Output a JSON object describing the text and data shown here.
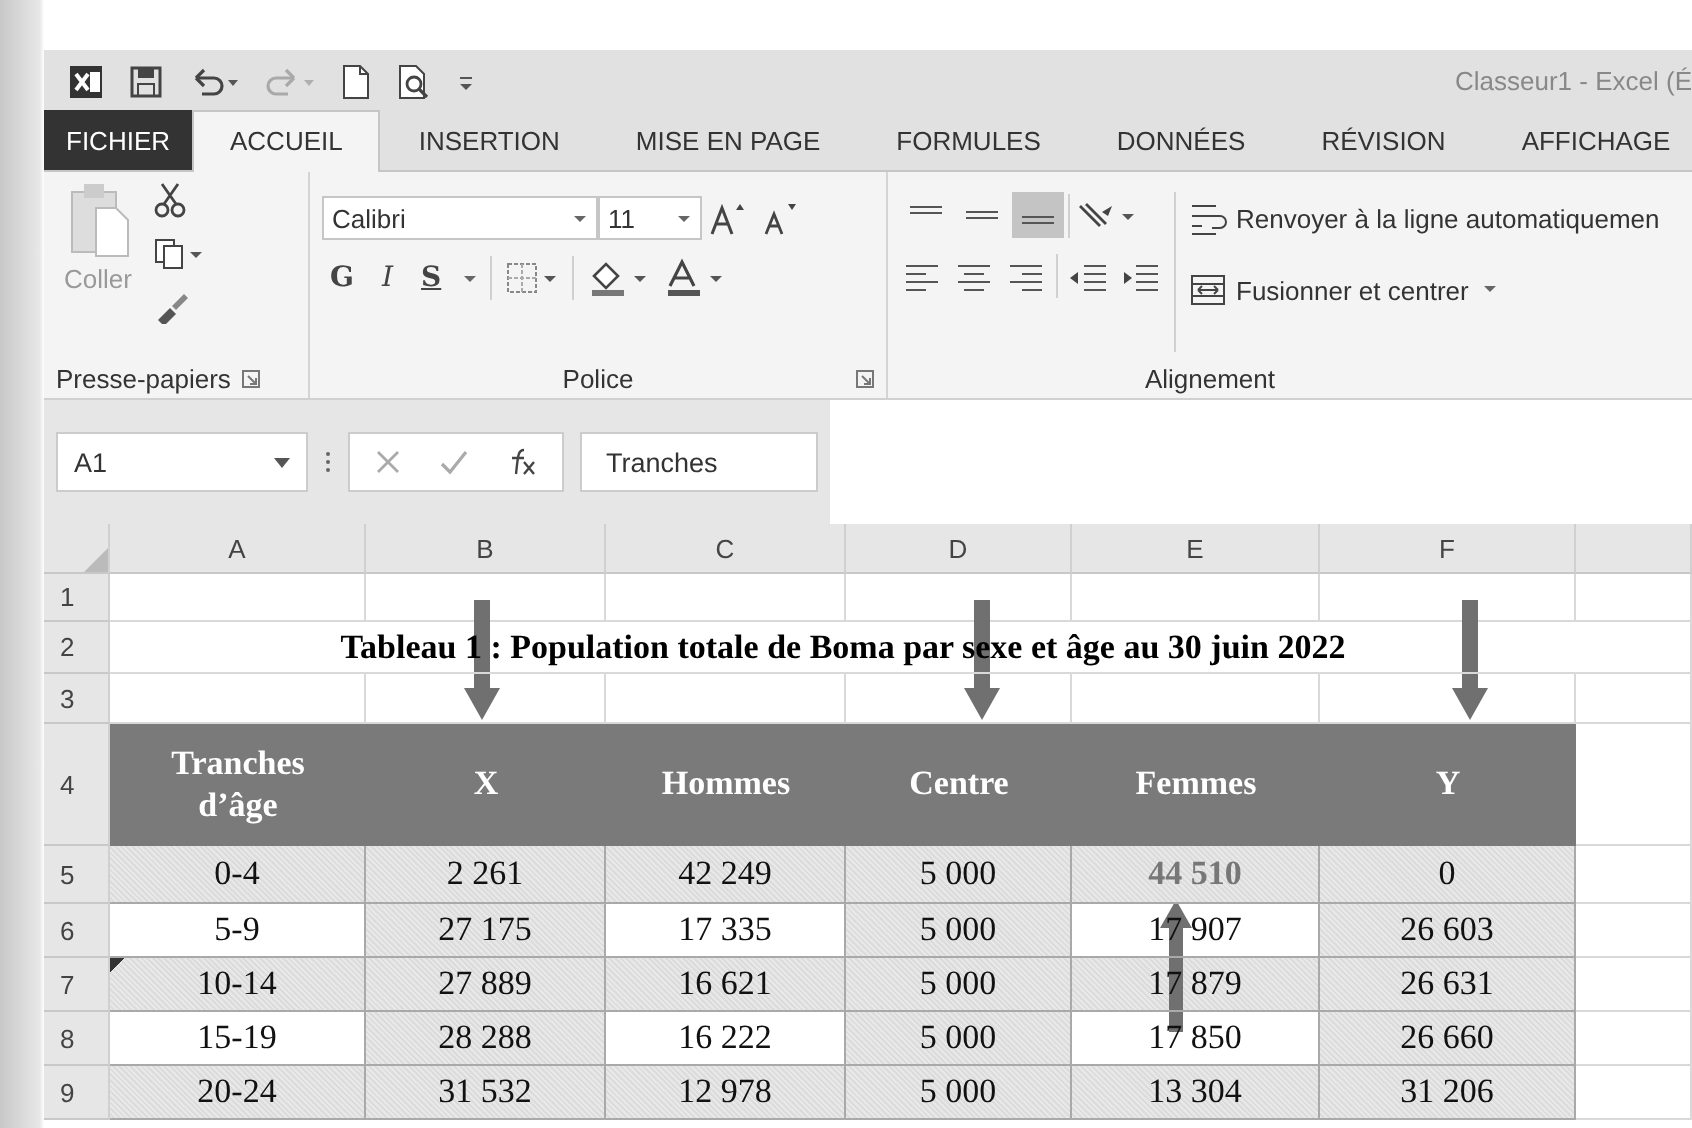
{
  "title_bar": {
    "quick_access": [
      {
        "kind": "excel",
        "disabled": false
      },
      {
        "kind": "save",
        "disabled": false
      },
      {
        "kind": "undo",
        "disabled": false
      },
      {
        "kind": "redo",
        "disabled": true
      },
      {
        "kind": "new",
        "disabled": false
      },
      {
        "kind": "preview",
        "disabled": false
      },
      {
        "kind": "customize",
        "disabled": false
      }
    ],
    "title": "Classeur1 - Excel (É"
  },
  "tabs": [
    {
      "label": "FICHIER",
      "kind": "file",
      "selected": false
    },
    {
      "label": "ACCUEIL",
      "kind": "tab",
      "selected": true
    },
    {
      "label": "INSERTION",
      "kind": "tab",
      "selected": false
    },
    {
      "label": "MISE EN PAGE",
      "kind": "tab",
      "selected": false
    },
    {
      "label": "FORMULES",
      "kind": "tab",
      "selected": false
    },
    {
      "label": "DONNÉES",
      "kind": "tab",
      "selected": false
    },
    {
      "label": "RÉVISION",
      "kind": "tab",
      "selected": false
    },
    {
      "label": "AFFICHAGE",
      "kind": "tab",
      "selected": false
    }
  ],
  "ribbon": {
    "clipboard": {
      "paste_label": "Coller",
      "group_label": "Presse-papiers"
    },
    "font": {
      "font_name": "Calibri",
      "font_size": "11",
      "bold_label": "G",
      "italic_label": "I",
      "underline_label": "S",
      "group_label": "Police"
    },
    "alignment": {
      "vertical": [
        {
          "kind": "top",
          "selected": false
        },
        {
          "kind": "middle",
          "selected": false
        },
        {
          "kind": "bottom",
          "selected": true
        }
      ],
      "wrap_label": "Renvoyer à la ligne automatiquemen",
      "merge_label": "Fusionner et centrer",
      "group_label": "Alignement"
    }
  },
  "formula_bar": {
    "name_box": "A1",
    "value": "Tranches"
  },
  "sheet": {
    "column_headers": [
      {
        "letter": "A",
        "arrow_down": false
      },
      {
        "letter": "B",
        "arrow_down": true
      },
      {
        "letter": "C",
        "arrow_down": false
      },
      {
        "letter": "D",
        "arrow_down": true
      },
      {
        "letter": "E",
        "arrow_down": false
      },
      {
        "letter": "F",
        "arrow_down": true
      }
    ],
    "row_numbers": [
      "1",
      "2",
      "3",
      "4",
      "5",
      "6",
      "7",
      "8",
      "9"
    ],
    "title": "Tableau 1 : Population totale de Boma par sexe et âge au 30 juin 2022",
    "table_header": [
      "Tranches d’âge",
      "X",
      "Hommes",
      "Centre",
      "Femmes",
      "Y"
    ],
    "rows": [
      [
        {
          "text": "0-4",
          "shaded": true
        },
        {
          "text": "2 261",
          "shaded": true
        },
        {
          "text": "42 249",
          "shaded": true
        },
        {
          "text": "5 000",
          "shaded": true
        },
        {
          "text": "44 510",
          "shaded": true,
          "emphasis": true
        },
        {
          "text": "0",
          "shaded": true
        }
      ],
      [
        {
          "text": "5-9",
          "shaded": false
        },
        {
          "text": "27 175",
          "shaded": true
        },
        {
          "text": "17 335",
          "shaded": false
        },
        {
          "text": "5 000",
          "shaded": true
        },
        {
          "text": "17 907",
          "shaded": false
        },
        {
          "text": "26 603",
          "shaded": true
        }
      ],
      [
        {
          "text": "10-14",
          "shaded": true,
          "error_mark": true
        },
        {
          "text": "27 889",
          "shaded": true
        },
        {
          "text": "16 621",
          "shaded": true
        },
        {
          "text": "5 000",
          "shaded": true
        },
        {
          "text": "17 879",
          "shaded": true,
          "arrow_up": true
        },
        {
          "text": "26 631",
          "shaded": true
        }
      ],
      [
        {
          "text": "15-19",
          "shaded": false
        },
        {
          "text": "28 288",
          "shaded": true
        },
        {
          "text": "16 222",
          "shaded": false
        },
        {
          "text": "5 000",
          "shaded": true
        },
        {
          "text": "17 850",
          "shaded": false
        },
        {
          "text": "26 660",
          "shaded": true
        }
      ],
      [
        {
          "text": "20-24",
          "shaded": true
        },
        {
          "text": "31 532",
          "shaded": true
        },
        {
          "text": "12 978",
          "shaded": true
        },
        {
          "text": "5 000",
          "shaded": true
        },
        {
          "text": "13 304",
          "shaded": true
        },
        {
          "text": "31 206",
          "shaded": true
        }
      ]
    ]
  }
}
